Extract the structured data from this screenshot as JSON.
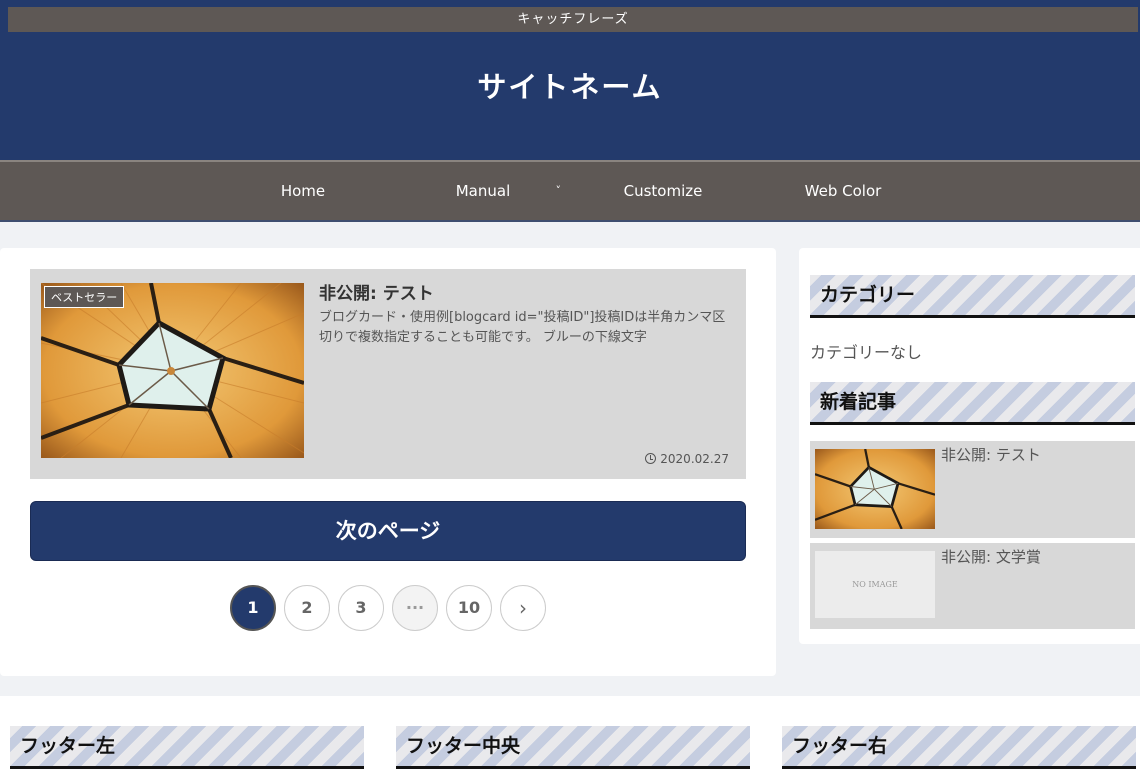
{
  "header": {
    "tagline": "キャッチフレーズ",
    "site_name": "サイトネーム",
    "background_color": "#233a6c",
    "bar_color": "#5e5855"
  },
  "nav": {
    "items": [
      {
        "label": "Home"
      },
      {
        "label": "Manual",
        "has_dropdown": true
      },
      {
        "label": "Customize"
      },
      {
        "label": "Web Color"
      }
    ],
    "dropdown_glyph": "˅"
  },
  "main": {
    "card": {
      "badge": "ベストセラー",
      "title": "非公開: テスト",
      "snippet": "ブログカード・使用例[blogcard id=\"投稿ID\"]投稿IDは半角カンマ区切りで複数指定することも可能です。 ブルーの下線文字",
      "date": "2020.02.27",
      "date_icon": "clock-icon",
      "thumbnail": "tent-ceiling-photo"
    },
    "next_button": "次のページ",
    "pagination": {
      "pages": [
        "1",
        "2",
        "3",
        "···",
        "10"
      ],
      "current": "1",
      "next_glyph": "›"
    }
  },
  "sidebar": {
    "category_title": "カテゴリー",
    "no_category": "カテゴリーなし",
    "recent_title": "新着記事",
    "recent": [
      {
        "title": "非公開: テスト",
        "thumbnail": "tent-ceiling-photo"
      },
      {
        "title": "非公開: 文学賞",
        "thumbnail_text": "NO IMAGE"
      }
    ]
  },
  "footer": {
    "left": "フッター左",
    "center": "フッター中央",
    "right": "フッター右"
  }
}
